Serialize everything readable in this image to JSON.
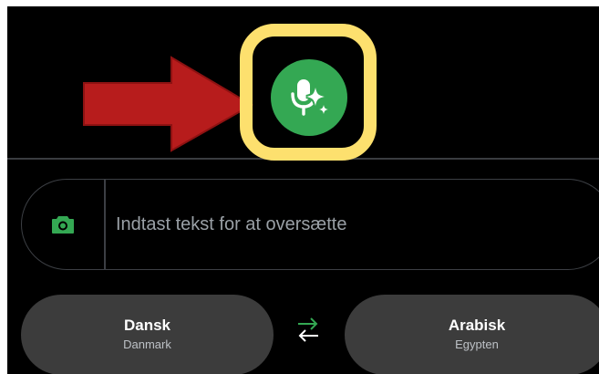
{
  "input": {
    "placeholder": "Indtast tekst for at oversætte"
  },
  "languages": {
    "source": {
      "name": "Dansk",
      "region": "Danmark"
    },
    "target": {
      "name": "Arabisk",
      "region": "Egypten"
    }
  },
  "colors": {
    "accent_green": "#34a853",
    "highlight_yellow": "#fde06e",
    "arrow_red": "#b71c1c",
    "background": "#000000",
    "pill": "#3c3c3c"
  },
  "icons": {
    "voice": "voice-sparkle-icon",
    "camera": "camera-icon",
    "swap": "swap-languages-icon",
    "annotation": "red-arrow-icon"
  }
}
